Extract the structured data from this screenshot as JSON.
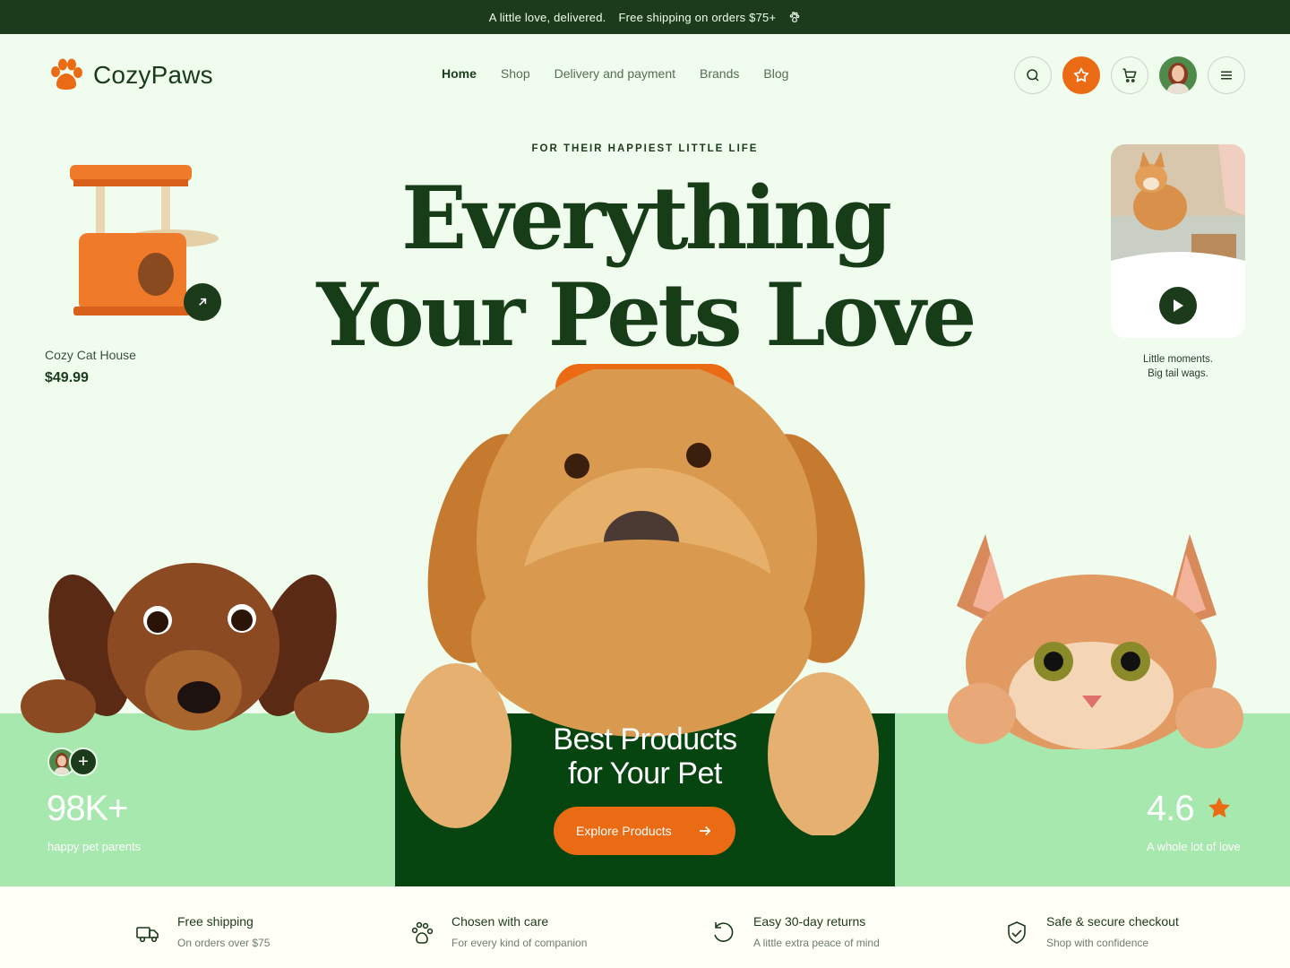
{
  "topbar": {
    "tagline": "A little love, delivered.",
    "shipping": "Free shipping on orders $75+",
    "icon": "paw-icon"
  },
  "brand": {
    "name": "CozyPaws",
    "logo_icon": "paw-icon",
    "accent": "#ea6b13",
    "dark": "#1b3b1a"
  },
  "nav": {
    "items": [
      {
        "label": "Home",
        "active": true
      },
      {
        "label": "Shop"
      },
      {
        "label": "Delivery and payment"
      },
      {
        "label": "Brands"
      },
      {
        "label": "Blog"
      }
    ]
  },
  "actions": {
    "icons": [
      "search-icon",
      "star-icon",
      "cart-icon",
      "avatar",
      "menu-icon"
    ]
  },
  "hero": {
    "eyebrow": "FOR THEIR HAPPIEST LITTLE LIFE",
    "title_line1": "Everything",
    "title_line2": "Your Pets Love"
  },
  "product": {
    "name": "Cozy Cat House",
    "price": "$49.99"
  },
  "video": {
    "caption_line1": "Little moments.",
    "caption_line2": "Big tail wags."
  },
  "stats": {
    "customers_value": "98K+",
    "customers_label": "happy pet parents",
    "rating_value": "4.6",
    "rating_label": "A whole lot of love"
  },
  "cta": {
    "title_line1": "Best Products",
    "title_line2": "for Your Pet",
    "button": "Explore Products"
  },
  "features": [
    {
      "title": "Free shipping",
      "subtitle": "On orders over $75",
      "icon": "truck-icon"
    },
    {
      "title": "Chosen with care",
      "subtitle": "For every kind of companion",
      "icon": "paw-icon"
    },
    {
      "title": "Easy 30-day returns",
      "subtitle": "A little extra peace of mind",
      "icon": "return-icon"
    },
    {
      "title": "Safe & secure checkout",
      "subtitle": "Shop with confidence",
      "icon": "shield-check-icon"
    }
  ]
}
